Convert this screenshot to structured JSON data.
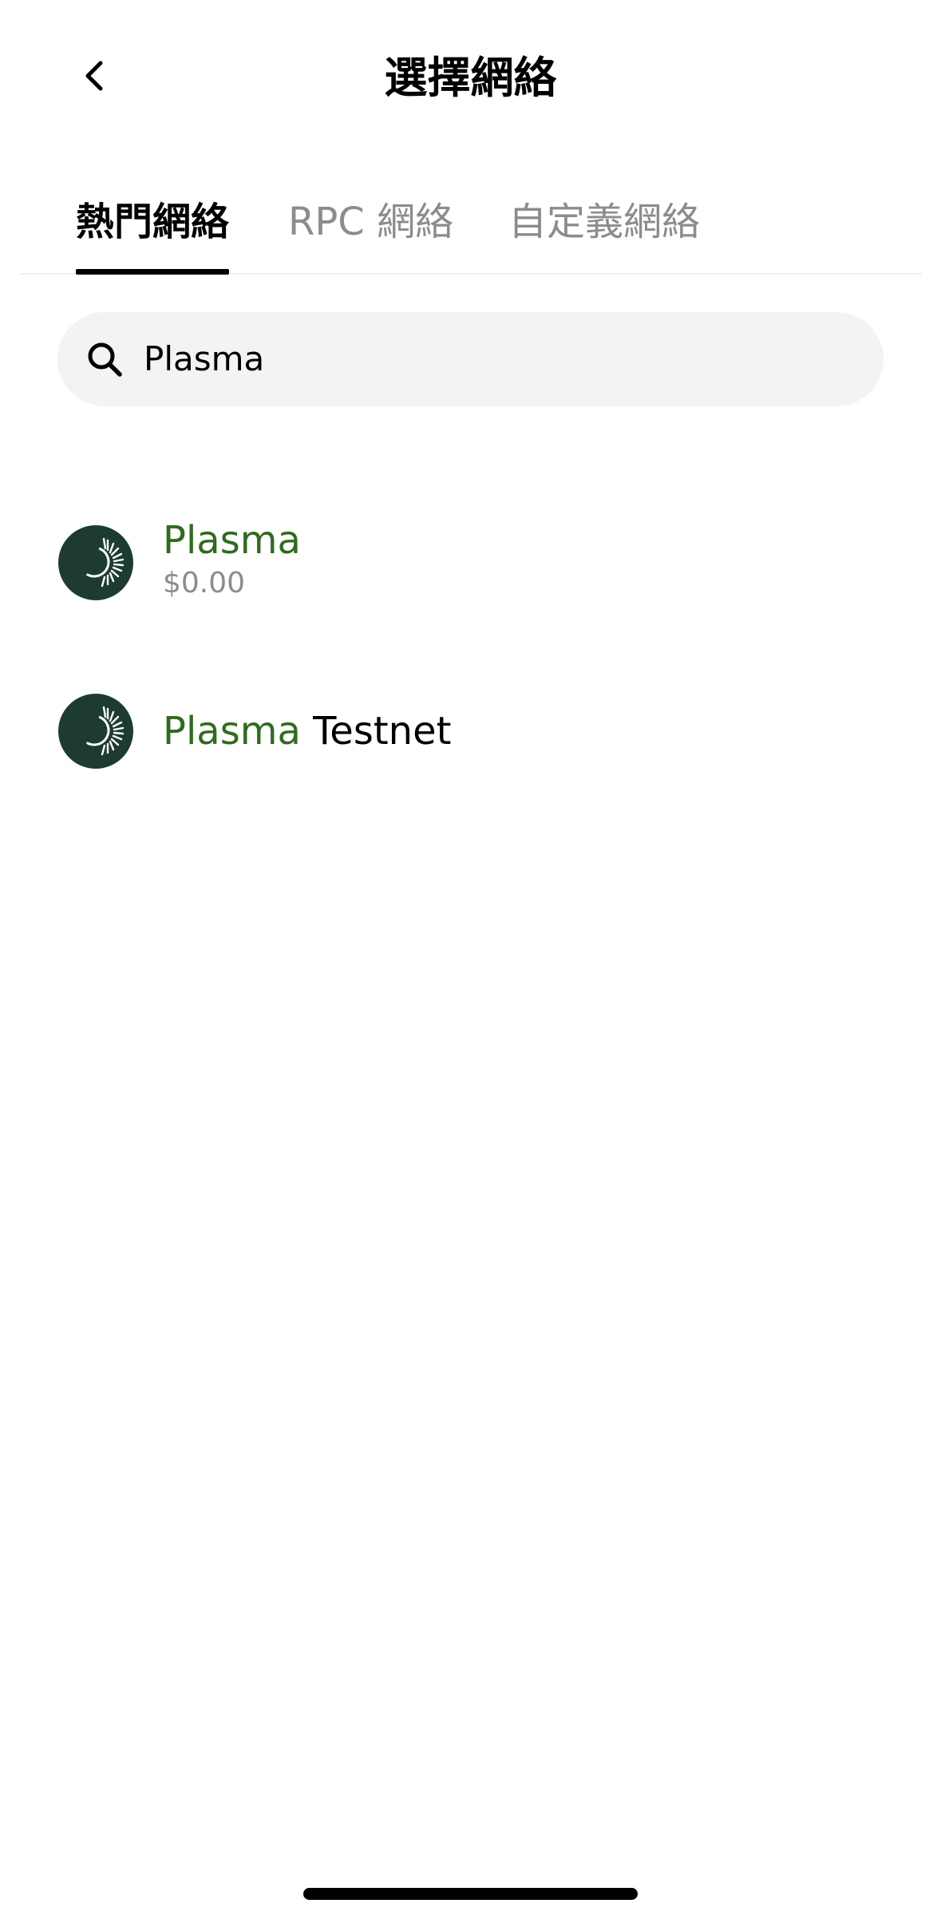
{
  "header": {
    "title": "選擇網絡",
    "back_icon": "chevron-left-icon"
  },
  "tabs": [
    {
      "label": "熱門網絡",
      "active": true
    },
    {
      "label": "RPC 網絡",
      "active": false
    },
    {
      "label": "自定義網絡",
      "active": false
    }
  ],
  "search": {
    "icon": "search-icon",
    "value": "Plasma"
  },
  "networks": [
    {
      "name_match": "Plasma",
      "name_rest": "",
      "balance": "$0.00",
      "icon": "plasma-logo-icon"
    },
    {
      "name_match": "Plasma",
      "name_rest": " Testnet",
      "icon": "plasma-logo-icon"
    }
  ],
  "colors": {
    "match_highlight": "#2f6b1e",
    "logo_bg": "#1d3b33",
    "search_bg": "#f3f3f3",
    "secondary_text": "#8c8c8c"
  }
}
